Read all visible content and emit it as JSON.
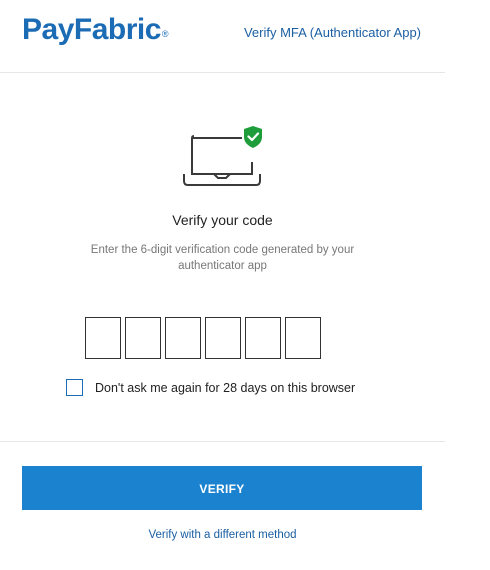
{
  "header": {
    "logo_pay": "Pay",
    "logo_fabric": "Fabric",
    "logo_reg": "®",
    "title": "Verify MFA (Authenticator App)"
  },
  "main": {
    "illustration_icon": "laptop-with-shield-icon",
    "title": "Verify your code",
    "subtitle": "Enter the 6-digit verification code generated by your authenticator app",
    "code_digits": [
      "",
      "",
      "",
      "",
      "",
      ""
    ],
    "remember_label": "Don't ask me again for 28 days on this browser",
    "remember_checked": false
  },
  "actions": {
    "verify_label": "VERIFY",
    "alt_method_label": "Verify with a different method"
  },
  "colors": {
    "brand_blue": "#1b6cb5",
    "button_blue": "#1b82cf",
    "shield_green": "#1f9d3a"
  }
}
